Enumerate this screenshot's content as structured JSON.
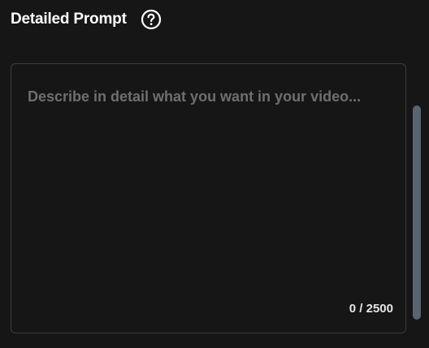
{
  "header": {
    "title": "Detailed Prompt",
    "help_icon": "question-circle-icon"
  },
  "prompt": {
    "value": "",
    "placeholder": "Describe in detail what you want in your video...",
    "counter_text": "0 / 2500"
  },
  "colors": {
    "background": "#161616",
    "border": "#3c3c3c",
    "placeholder": "#6f6f6f",
    "text": "#ffffff",
    "scrollbar_thumb": "#596470"
  }
}
